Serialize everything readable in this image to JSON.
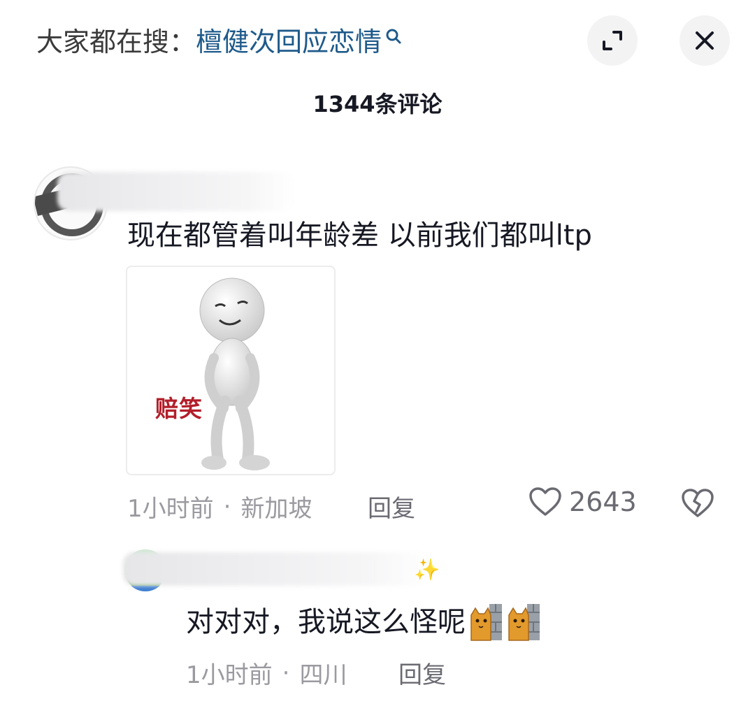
{
  "header": {
    "search_prefix": "大家都在搜：",
    "search_query": "檀健次回应恋情",
    "expand_icon": "expand-icon",
    "close_icon": "close-icon"
  },
  "comment_count": "1344条评论",
  "comments": [
    {
      "text": "现在都管着叫年龄差 以前我们都叫ltp",
      "sticker_caption": "赔笑",
      "time": "1小时前",
      "location": "新加坡",
      "reply_label": "回复",
      "likes": "2643",
      "replies": [
        {
          "text": "对对对，我说这么怪呢",
          "emojis": [
            "cat-hiding-icon",
            "cat-hiding-icon"
          ],
          "time": "1小时前",
          "location": "四川",
          "reply_label": "回复"
        }
      ]
    }
  ],
  "colors": {
    "query_link": "#1e5a8a",
    "meta_text": "#9a9aa0",
    "sticker_caption": "#b21f2a"
  }
}
